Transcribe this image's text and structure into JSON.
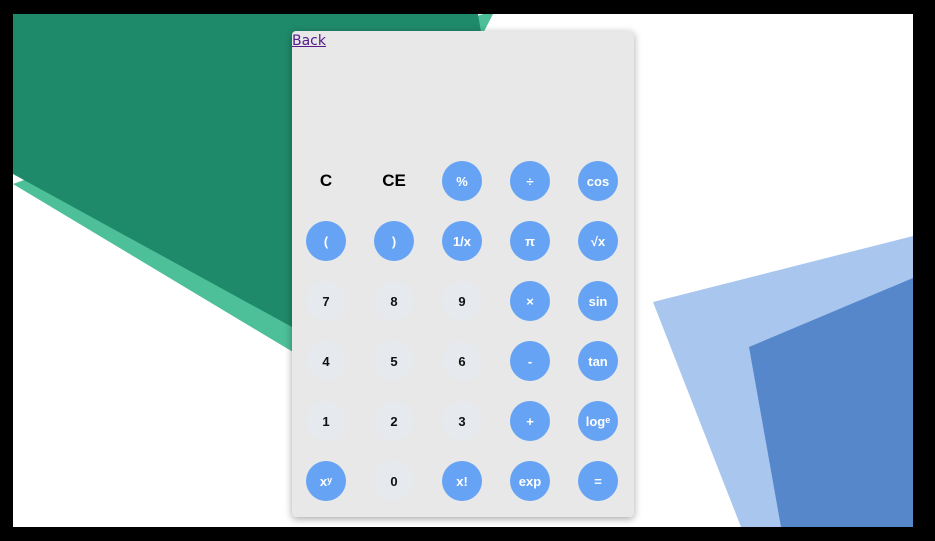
{
  "nav": {
    "back_label": "Back"
  },
  "display": {
    "value": ""
  },
  "keys": [
    [
      {
        "label": "C",
        "kind": "plain"
      },
      {
        "label": "CE",
        "kind": "plain"
      },
      {
        "label": "%",
        "kind": "op"
      },
      {
        "label": "÷",
        "kind": "op"
      },
      {
        "label": "cos",
        "kind": "op"
      }
    ],
    [
      {
        "label": "(",
        "kind": "op"
      },
      {
        "label": ")",
        "kind": "op"
      },
      {
        "label": "1/x",
        "kind": "op"
      },
      {
        "label": "π",
        "kind": "op"
      },
      {
        "label": "√x",
        "kind": "op"
      }
    ],
    [
      {
        "label": "7",
        "kind": "num"
      },
      {
        "label": "8",
        "kind": "num"
      },
      {
        "label": "9",
        "kind": "num"
      },
      {
        "label": "×",
        "kind": "op"
      },
      {
        "label": "sin",
        "kind": "op"
      }
    ],
    [
      {
        "label": "4",
        "kind": "num"
      },
      {
        "label": "5",
        "kind": "num"
      },
      {
        "label": "6",
        "kind": "num"
      },
      {
        "label": "-",
        "kind": "op"
      },
      {
        "label": "tan",
        "kind": "op"
      }
    ],
    [
      {
        "label": "1",
        "kind": "num"
      },
      {
        "label": "2",
        "kind": "num"
      },
      {
        "label": "3",
        "kind": "num"
      },
      {
        "label": "+",
        "kind": "op"
      },
      {
        "label": "log",
        "sup": "e",
        "kind": "op"
      }
    ],
    [
      {
        "label": "x",
        "sup": "y",
        "kind": "op"
      },
      {
        "label": "0",
        "kind": "num"
      },
      {
        "label": "x!",
        "kind": "op"
      },
      {
        "label": "exp",
        "kind": "op"
      },
      {
        "label": "=",
        "kind": "op"
      }
    ]
  ],
  "colors": {
    "operator_button": "#66a3f4",
    "number_button": "#e6e9ed",
    "panel": "#e8e8e8",
    "background_green_dark": "#1f8a6a",
    "background_green_light": "#4dbf99",
    "background_blue_light": "#a9c6ef",
    "background_blue_dark": "#5687cb"
  }
}
